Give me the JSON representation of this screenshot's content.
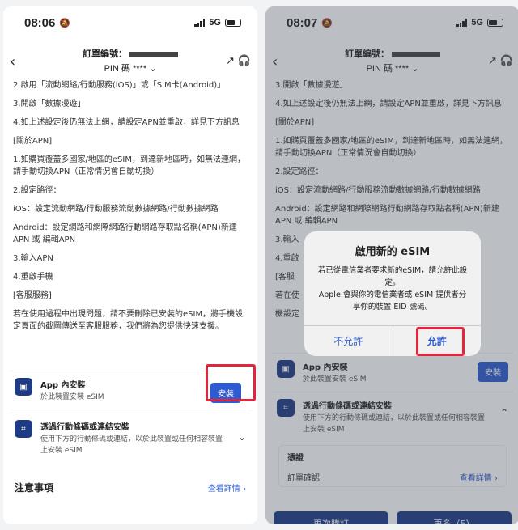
{
  "left": {
    "status": {
      "time": "08:06",
      "network": "5G"
    },
    "nav": {
      "order_label": "訂單編號：",
      "pin_label": "PIN 碼 ****"
    },
    "paragraphs": [
      "2.啟用「流動網絡/行動服務(iOS)」或「SIM卡(Android)」",
      "3.開啟「數據漫遊」",
      "4.如上述設定後仍無法上網，請設定APN並重啟，詳見下方訊息",
      "[關於APN]",
      "1.如購買覆蓋多國家/地區的eSIM，到達新地區時，如無法連網，請手動切換APN（正常情況會自動切換）",
      "2.設定路徑：",
      "iOS：設定流動網路/行動服務流動數據網路/行動數據網路",
      "Android：設定網路和網際網路行動網路存取點名稱(APN)新建APN 或 編輯APN",
      "3.輸入APN",
      "4.重啟手機",
      "[客服服務]",
      "若在使用過程中出現問題，請不要刪除已安裝的eSIM，將手機設定頁面的截圖傳送至客服服務，我們將為您提供快速支援。"
    ],
    "app_install": {
      "title": "App 內安裝",
      "subtitle": "於此裝置安裝 eSIM",
      "button": "安裝"
    },
    "qr_install": {
      "title": "透過行動條碼或連結安裝",
      "subtitle": "使用下方的行動條碼或連結，以於此裝置或任何相容裝置上安裝 eSIM"
    },
    "notes": {
      "title": "注意事項",
      "more": "查看詳情"
    }
  },
  "right": {
    "status": {
      "time": "08:07",
      "network": "5G"
    },
    "nav": {
      "order_label": "訂單編號：",
      "pin_label": "PIN 碼 ****"
    },
    "paragraphs": [
      "3.開啟「數據漫遊」",
      "4.如上述設定後仍無法上網，請設定APN並重啟，詳見下方訊息",
      "[關於APN]",
      "1.如購買覆蓋多國家/地區的eSIM，到達新地區時，如無法連網，請手動切換APN（正常情況會自動切換）",
      "2.設定路徑：",
      "iOS：設定流動網路/行動服務流動數據網路/行動數據網路",
      "Android：設定網路和網際網路行動網路存取點名稱(APN)新建APN 或 編輯APN",
      "3.輸入",
      "4.重啟",
      "[客服",
      "若在使",
      "機設定"
    ],
    "alert": {
      "title": "啟用新的 eSIM",
      "message1": "若已從電信業者要求新的eSIM，請允許此設定。",
      "message2": "Apple 會與你的電信業者或 eSIM 提供者分享你的裝置 EID 號碼。",
      "deny": "不允許",
      "allow": "允許"
    },
    "app_install": {
      "title": "App 內安裝",
      "subtitle": "於此裝置安裝 eSIM",
      "button": "安裝"
    },
    "qr_install": {
      "title": "透過行動條碼或連結安裝",
      "subtitle": "使用下方的行動條碼或連結，以於此裝置或任何相容裝置上安裝 eSIM"
    },
    "cert": {
      "title": "憑證",
      "label": "訂單確認",
      "more": "查看詳情"
    },
    "footer": {
      "left": "再次購訂",
      "right": "更多（5）"
    }
  },
  "colors": {
    "accent": "#2f5bd0",
    "navy": "#1f3b84",
    "highlight": "#e0263a"
  }
}
